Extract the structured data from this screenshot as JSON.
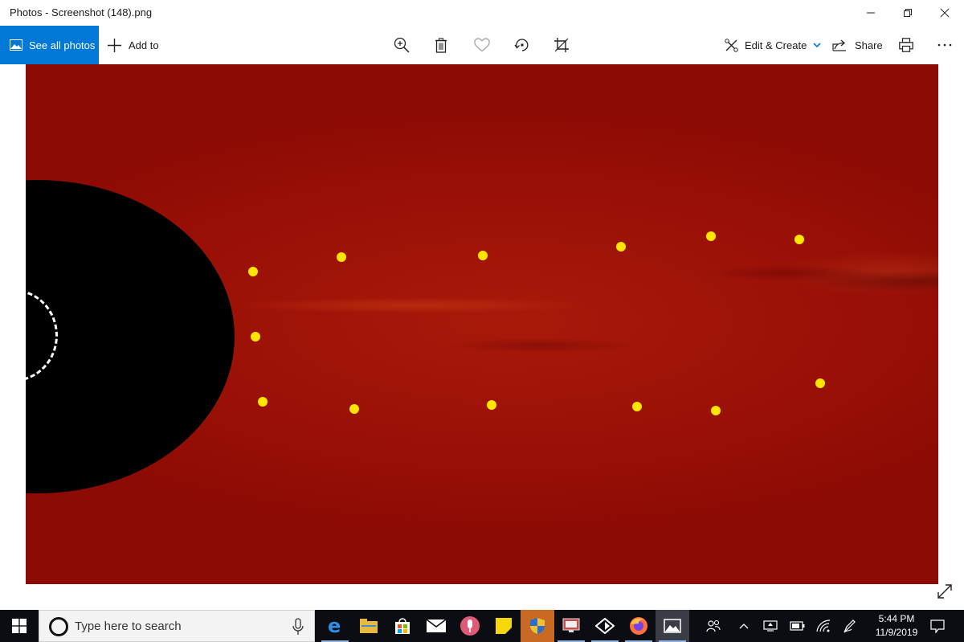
{
  "window": {
    "title": "Photos - Screenshot (148).png"
  },
  "toolbar": {
    "see_all_photos": "See all photos",
    "add_to": "Add to",
    "edit_create": "Edit & Create",
    "share": "Share",
    "icons": [
      "zoom-in-icon",
      "delete-icon",
      "favorite-icon",
      "rotate-icon",
      "crop-icon",
      "print-icon",
      "more-icon"
    ]
  },
  "image": {
    "description_colors": {
      "background": "#9c1208",
      "occulter": "#000000",
      "markers": "#ffe600"
    },
    "marker_count": 12
  },
  "taskbar": {
    "search_placeholder": "Type here to search",
    "time": "5:44 PM",
    "date": "11/9/2019"
  },
  "colors": {
    "accent": "#0078d7",
    "taskbar": "#0b0d13"
  }
}
